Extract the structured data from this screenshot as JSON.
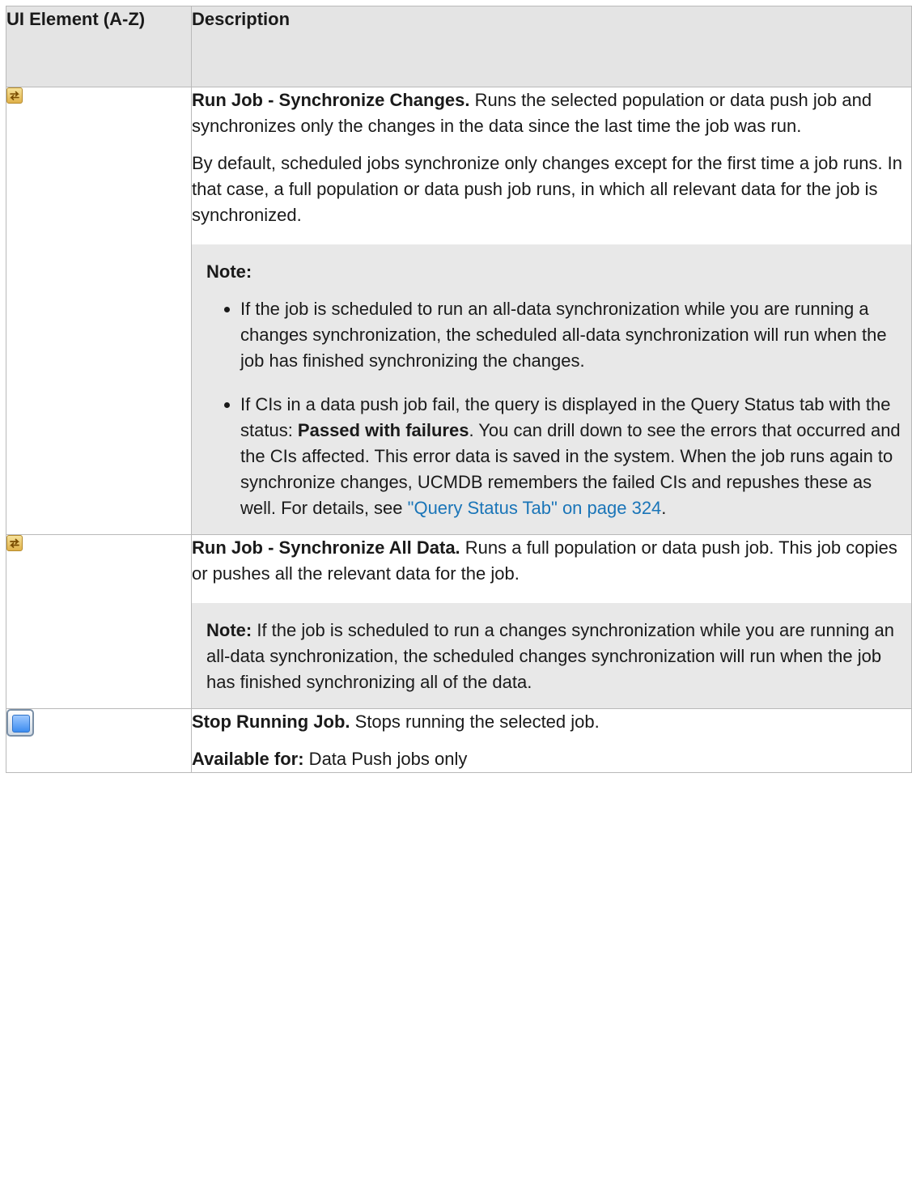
{
  "table": {
    "header": {
      "col1": "UI Element (A-Z)",
      "col2": "Description"
    },
    "rows": [
      {
        "icon": "sync-changes-icon",
        "title": "Run Job - Synchronize Changes.",
        "text1": " Runs the selected population or data push job and synchronizes only the changes in the data since the last time the job was run.",
        "para2": "By default, scheduled jobs synchronize only changes except for the first time a job runs. In that case, a full population or data push job runs, in which all relevant data for the job is synchronized.",
        "note": {
          "label": "Note:",
          "bullet1": "If the job is scheduled to run an all-data synchronization while you are running a changes synchronization, the scheduled all-data synchronization will run when the job has finished synchronizing the changes.",
          "bullet2_pre": "If CIs in a data push job fail, the query is displayed in the Query Status tab with the status: ",
          "bullet2_bold": "Passed with failures",
          "bullet2_mid": ". You can drill down to see the errors that occurred and the CIs affected. This error data is saved in the system. When the job runs again to synchronize changes, UCMDB remembers the failed CIs and repushes these as well. For details, see ",
          "bullet2_link": "\"Query Status Tab\" on page 324",
          "bullet2_end": "."
        }
      },
      {
        "icon": "sync-all-data-icon",
        "title": "Run Job - Synchronize All Data.",
        "text1": " Runs a full population or data push job. This job copies or pushes all the relevant data for the job.",
        "note": {
          "label": "Note:",
          "text": " If the job is scheduled to run a changes synchronization while you are running an all-data synchronization, the scheduled changes synchronization will run when the job has finished synchronizing all of the data."
        }
      },
      {
        "icon": "stop-icon",
        "title": "Stop Running Job.",
        "text1": " Stops running the selected job.",
        "avail_label": "Available for:",
        "avail_text": " Data Push jobs only"
      }
    ]
  },
  "colors": {
    "header_bg": "#e4e4e4",
    "note_bg": "#e8e8e8",
    "link": "#1a75b8",
    "border": "#b9b9b9"
  }
}
